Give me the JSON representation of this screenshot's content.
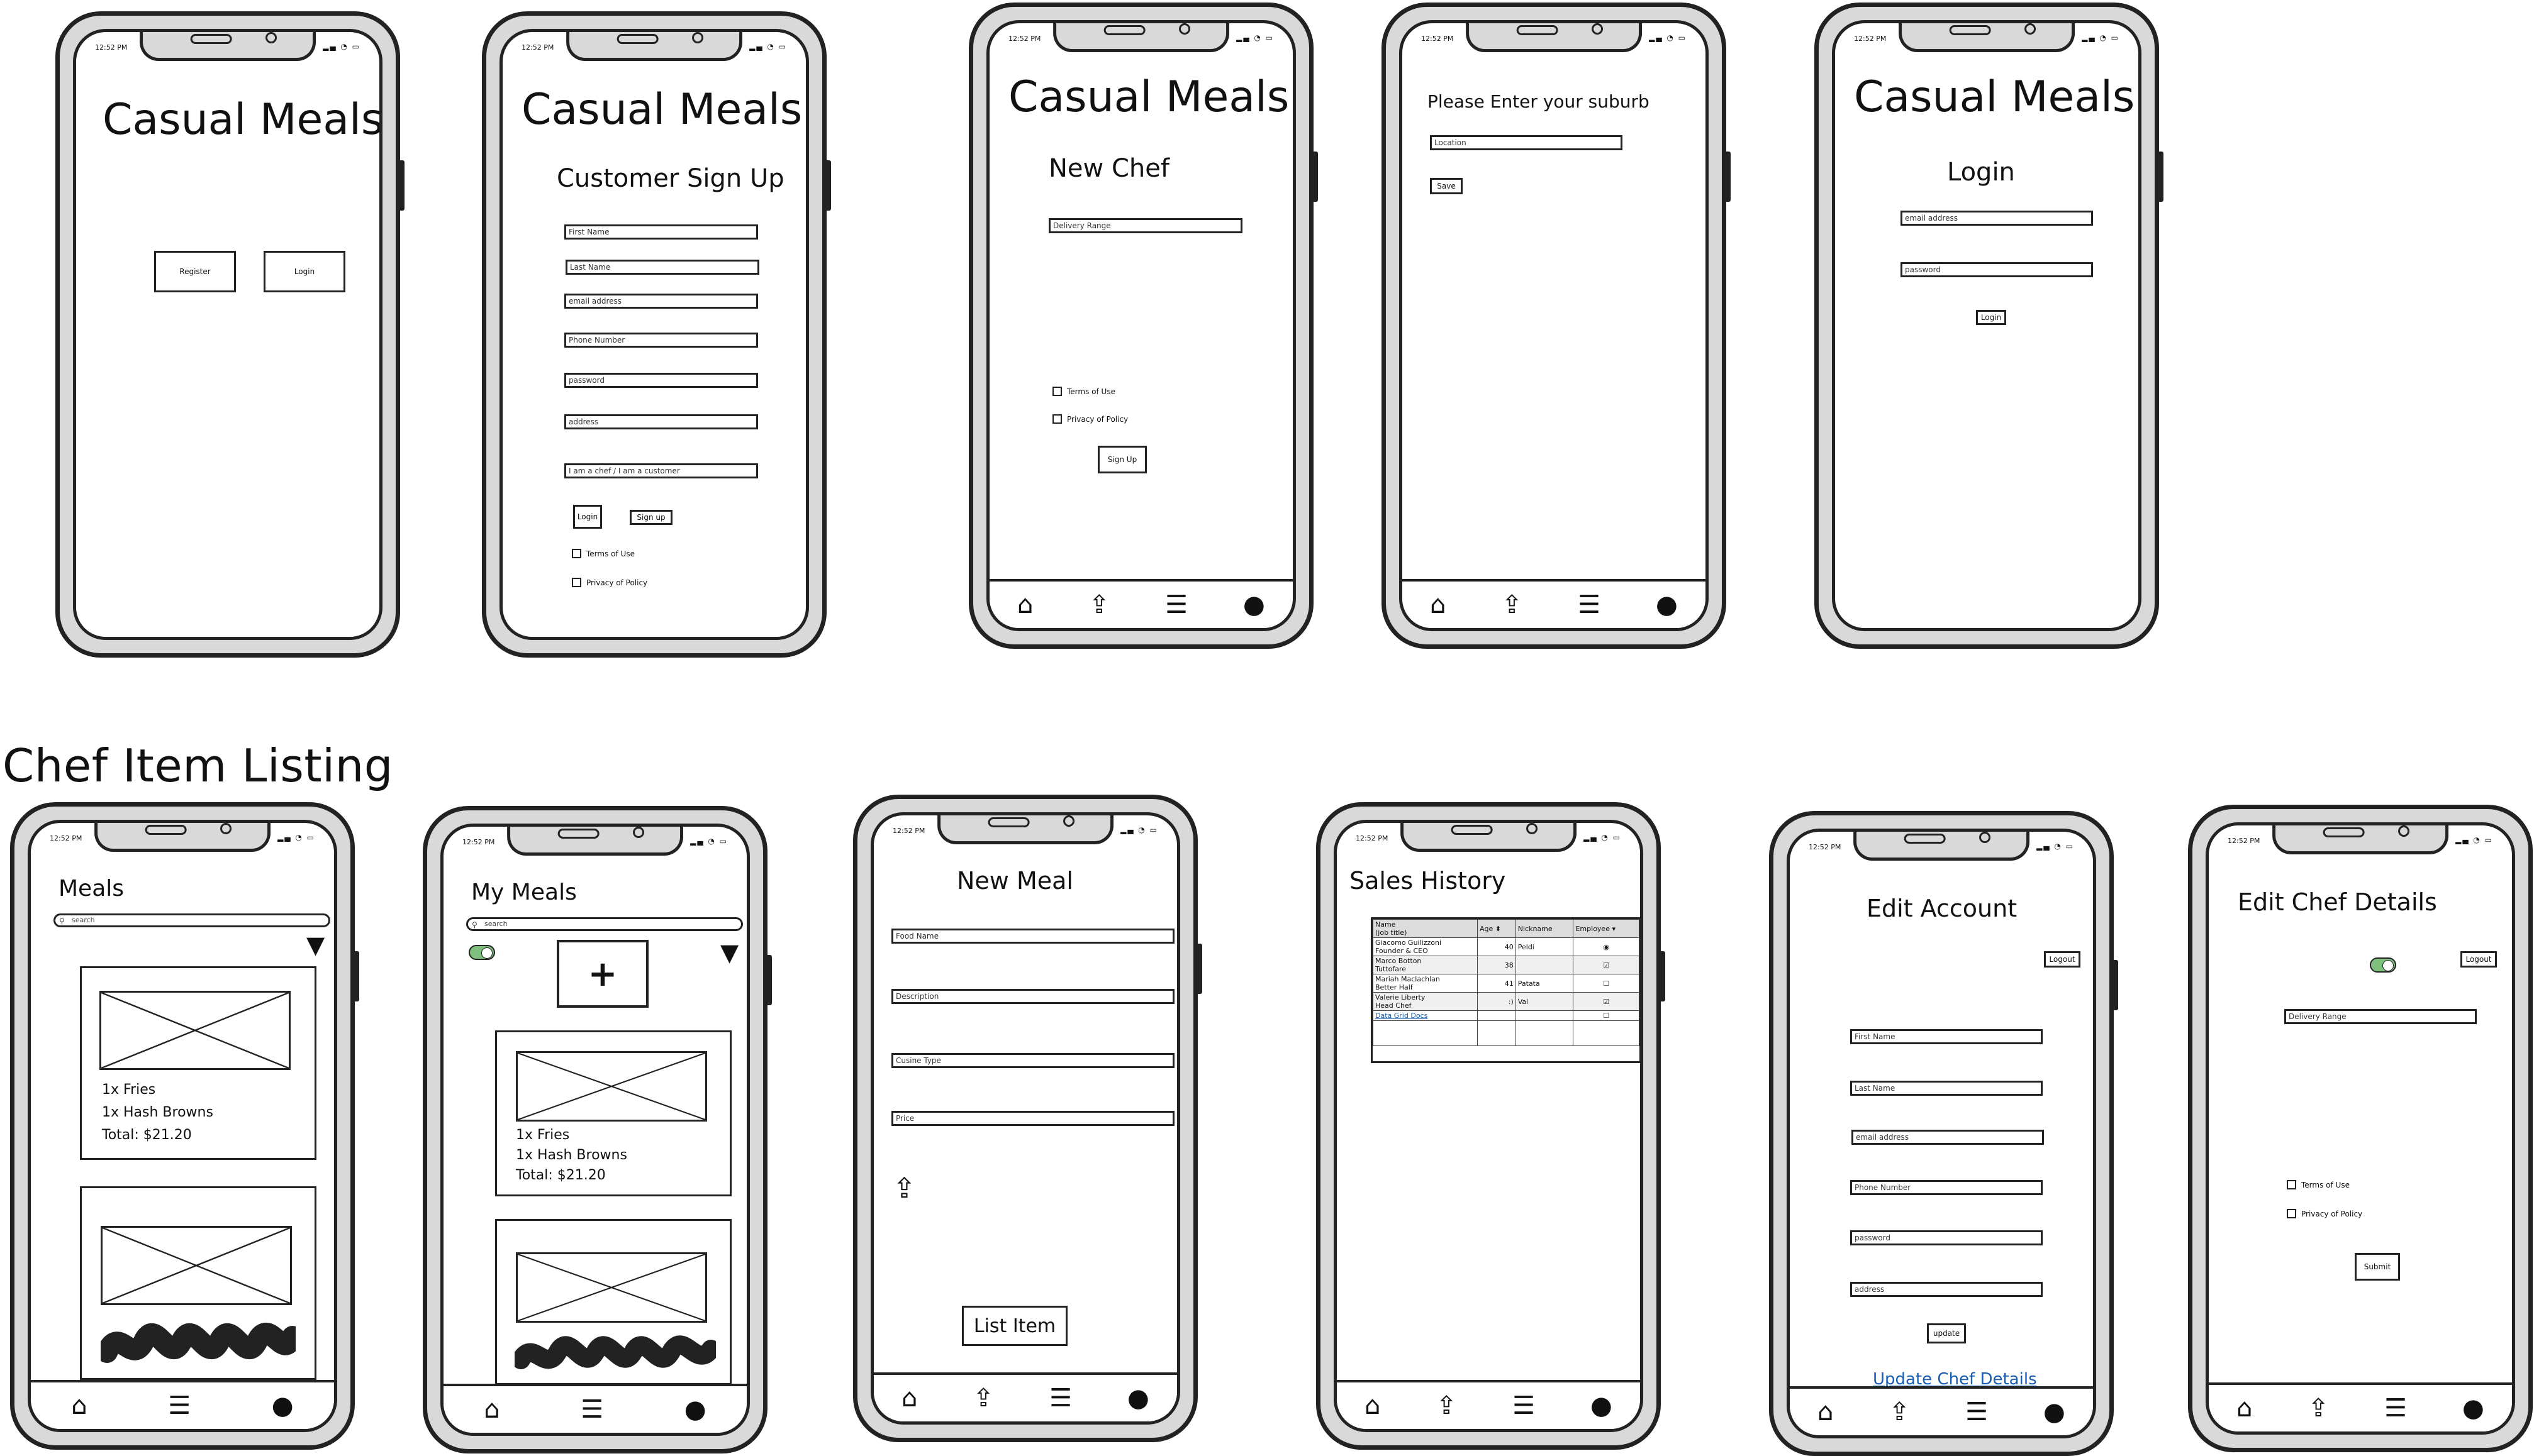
{
  "status": {
    "time": "12:52 PM",
    "icons": "▂▄ ◔ ▭"
  },
  "nav": {
    "home": "⌂",
    "upload": "⇪",
    "list": "☰",
    "profile": "●"
  },
  "section_title": "Chef Item Listing",
  "screen1": {
    "title": "Casual Meals",
    "register": "Register",
    "login": "Login"
  },
  "screen2": {
    "title": "Casual Meals",
    "subtitle": "Customer Sign Up",
    "fields": [
      "First Name",
      "Last Name",
      "email address",
      "Phone Number",
      "password",
      "address",
      "I am a chef / I am a customer"
    ],
    "login": "Login",
    "signup": "Sign up",
    "terms": "Terms of Use",
    "privacy": "Privacy of Policy"
  },
  "screen3": {
    "title": "Casual Meals",
    "subtitle": "New Chef",
    "field": "Delivery Range",
    "terms": "Terms of Use",
    "privacy": "Privacy of Policy",
    "signup": "Sign Up"
  },
  "screen4": {
    "prompt": "Please Enter your suburb",
    "field": "Location",
    "save": "Save"
  },
  "screen5": {
    "title": "Casual Meals",
    "subtitle": "Login",
    "email": "email address",
    "password": "password",
    "login": "Login"
  },
  "screen6": {
    "title": "Meals",
    "search": "search",
    "card1": {
      "line1": "1x Fries",
      "line2": "1x Hash Browns",
      "total": "Total: $21.20"
    }
  },
  "screen7": {
    "title": "My Meals",
    "search": "search",
    "add": "+",
    "card1": {
      "line1": "1x Fries",
      "line2": "1x Hash Browns",
      "total": "Total: $21.20"
    }
  },
  "screen8": {
    "title": "New Meal",
    "fields": [
      "Food Name",
      "Description",
      "Cusine Type",
      "Price"
    ],
    "list_item": "List Item"
  },
  "screen9": {
    "title": "Sales History",
    "columns": [
      "Name\n(job title)",
      "Age ⬍",
      "Nickname",
      "Employee ▾"
    ],
    "rows": [
      {
        "name": "Giacomo Guilizzoni\nFounder & CEO",
        "age": "40",
        "nick": "Peldi",
        "emp": "◉"
      },
      {
        "name": "Marco Botton\nTuttofare",
        "age": "38",
        "nick": "",
        "emp": "☑"
      },
      {
        "name": "Mariah Maclachlan\nBetter Half",
        "age": "41",
        "nick": "Patata",
        "emp": "☐"
      },
      {
        "name": "Valerie Liberty\nHead Chef",
        "age": ":)",
        "nick": "Val",
        "emp": "☑"
      },
      {
        "name": "Data Grid Docs",
        "age": "",
        "nick": "",
        "emp": "☐"
      }
    ]
  },
  "screen10": {
    "title": "Edit Account",
    "logout": "Logout",
    "fields": [
      "First Name",
      "Last Name",
      "email address",
      "Phone Number",
      "password",
      "address"
    ],
    "update": "update",
    "link": "Update Chef Details"
  },
  "screen11": {
    "title": "Edit Chef Details",
    "logout": "Logout",
    "field": "Delivery Range",
    "terms": "Terms of Use",
    "privacy": "Privacy of Policy",
    "submit": "Submit"
  }
}
